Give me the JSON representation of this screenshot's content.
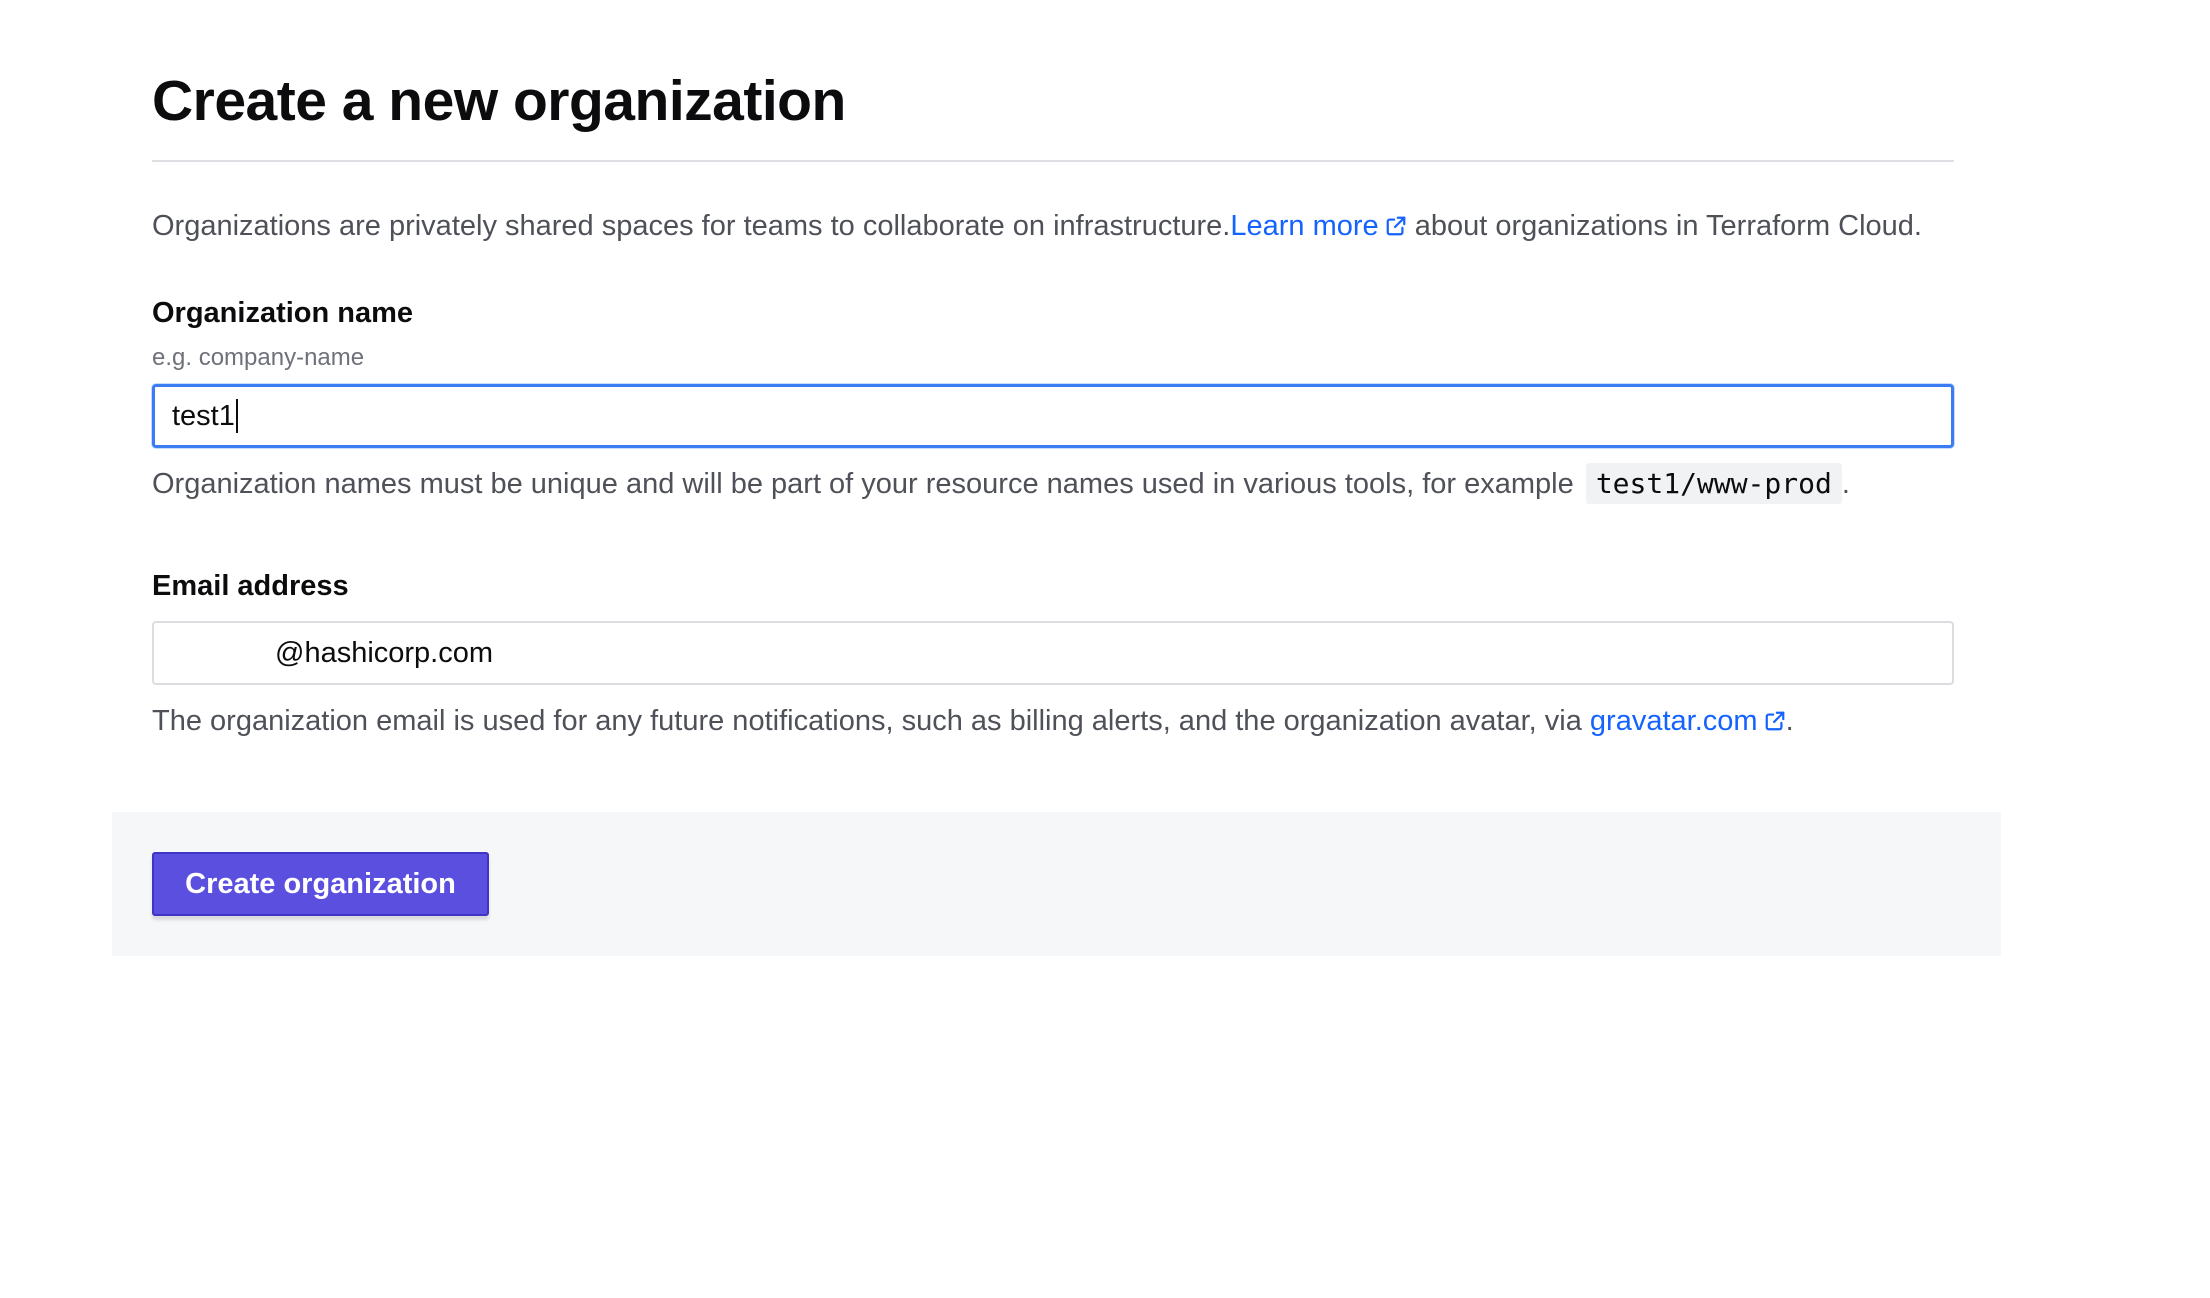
{
  "page": {
    "title": "Create a new organization",
    "intro": {
      "text_before": "Organizations are privately shared spaces for teams to collaborate on infrastructure.",
      "link_label": "Learn more",
      "text_after": " about organizations in Terraform Cloud."
    }
  },
  "form": {
    "org_name": {
      "label": "Organization name",
      "hint": "e.g. company-name",
      "value": "test1",
      "help_before": "Organization names must be unique and will be part of your resource names used in various tools, for example",
      "help_code": "test1/www-prod",
      "help_after": "."
    },
    "email": {
      "label": "Email address",
      "value": "@hashicorp.com",
      "help_before": "The organization email is used for any future notifications, such as billing alerts, and the organization avatar, via ",
      "link_label": "gravatar.com",
      "help_after": "."
    },
    "submit_label": "Create organization"
  },
  "icons": {
    "external_link": "external-link-icon"
  },
  "colors": {
    "link": "#1563ff",
    "primary_button": "#5b4fe0",
    "focus_border": "#3b7cf5",
    "footer_bg": "#f6f7f9"
  }
}
